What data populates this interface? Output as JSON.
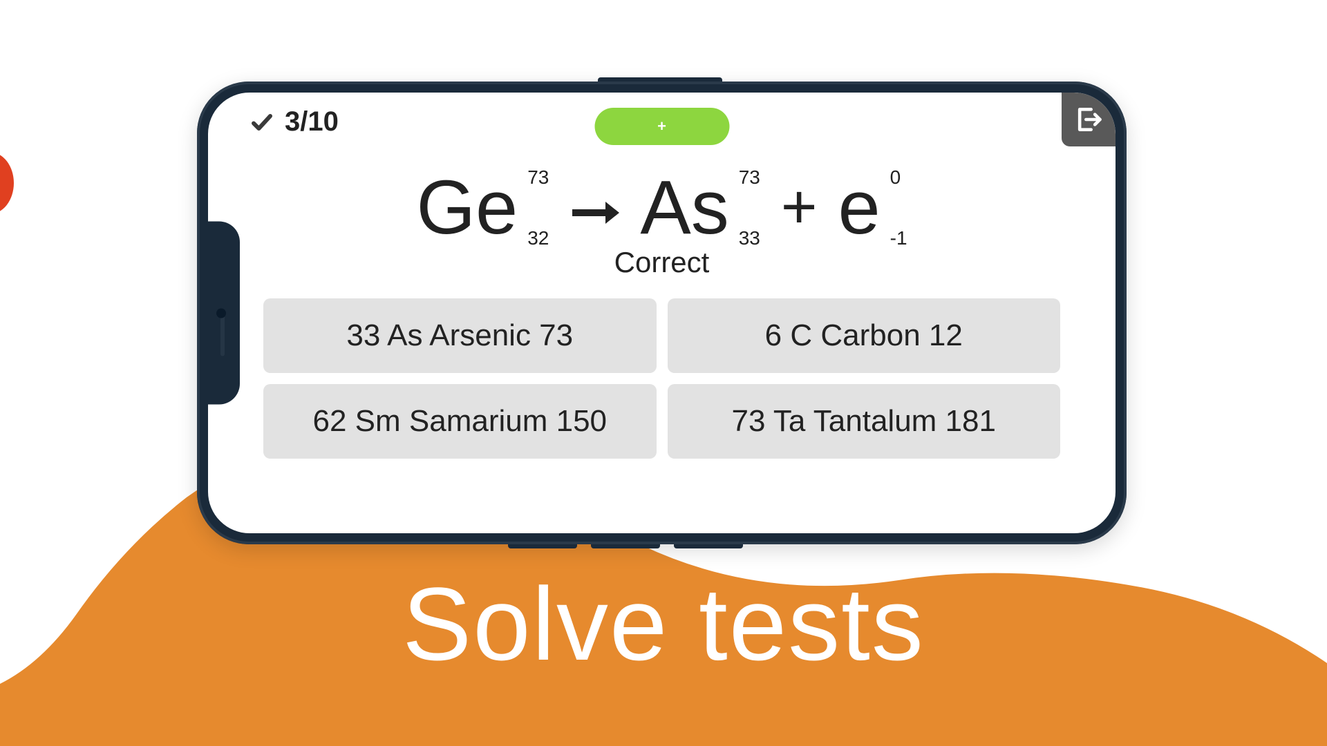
{
  "headline": "Solve tests",
  "top": {
    "score": "3/10",
    "pill_label": "+"
  },
  "equation": {
    "left": {
      "symbol": "Ge",
      "top": "73",
      "bottom": "32"
    },
    "middle": {
      "symbol": "As",
      "top": "73",
      "bottom": "33"
    },
    "right": {
      "symbol": "e",
      "top": "0",
      "bottom": "-1"
    },
    "status": "Correct"
  },
  "answers": [
    "33 As Arsenic 73",
    "6 C Carbon 12",
    "62 Sm Samarium 150",
    "73 Ta Tantalum 181"
  ]
}
